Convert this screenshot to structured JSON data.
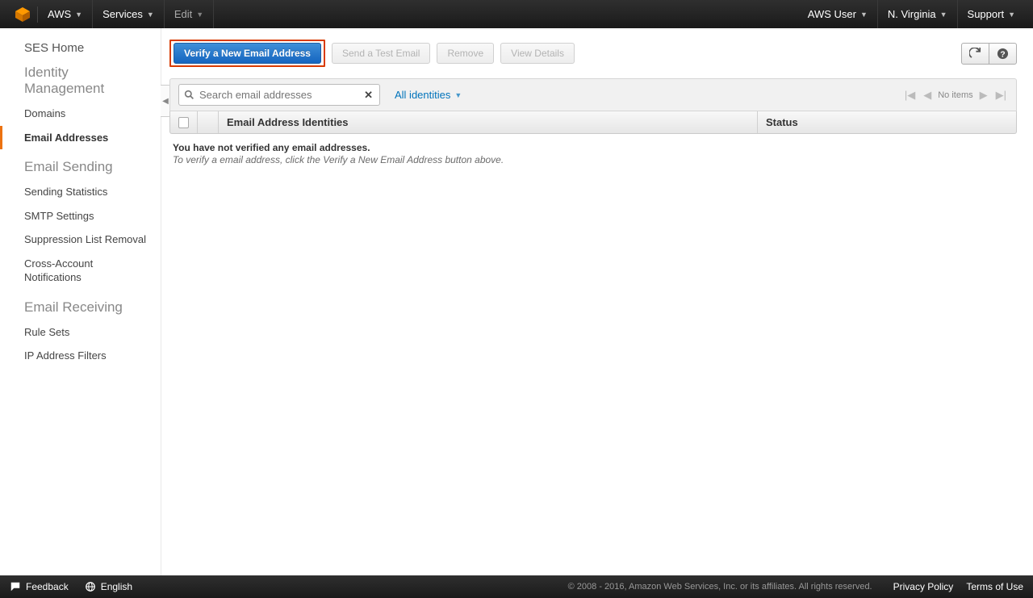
{
  "topnav": {
    "brand": "AWS",
    "services": "Services",
    "edit": "Edit",
    "user": "AWS User",
    "region": "N. Virginia",
    "support": "Support"
  },
  "sidebar": {
    "home": "SES Home",
    "identity_heading": "Identity Management",
    "domains": "Domains",
    "email_addresses": "Email Addresses",
    "sending_heading": "Email Sending",
    "sending_stats": "Sending Statistics",
    "smtp": "SMTP Settings",
    "suppression": "Suppression List Removal",
    "cross_account": "Cross-Account Notifications",
    "receiving_heading": "Email Receiving",
    "rule_sets": "Rule Sets",
    "ip_filters": "IP Address Filters"
  },
  "toolbar": {
    "verify": "Verify a New Email Address",
    "send_test": "Send a Test Email",
    "remove": "Remove",
    "view_details": "View Details"
  },
  "filter": {
    "placeholder": "Search email addresses",
    "dropdown": "All identities",
    "no_items": "No items"
  },
  "table": {
    "col_name": "Email Address Identities",
    "col_status": "Status"
  },
  "empty": {
    "line1": "You have not verified any email addresses.",
    "line2": "To verify a email address, click the Verify a New Email Address button above."
  },
  "footer": {
    "feedback": "Feedback",
    "language": "English",
    "copyright": "© 2008 - 2016, Amazon Web Services, Inc. or its affiliates. All rights reserved.",
    "privacy": "Privacy Policy",
    "terms": "Terms of Use"
  }
}
